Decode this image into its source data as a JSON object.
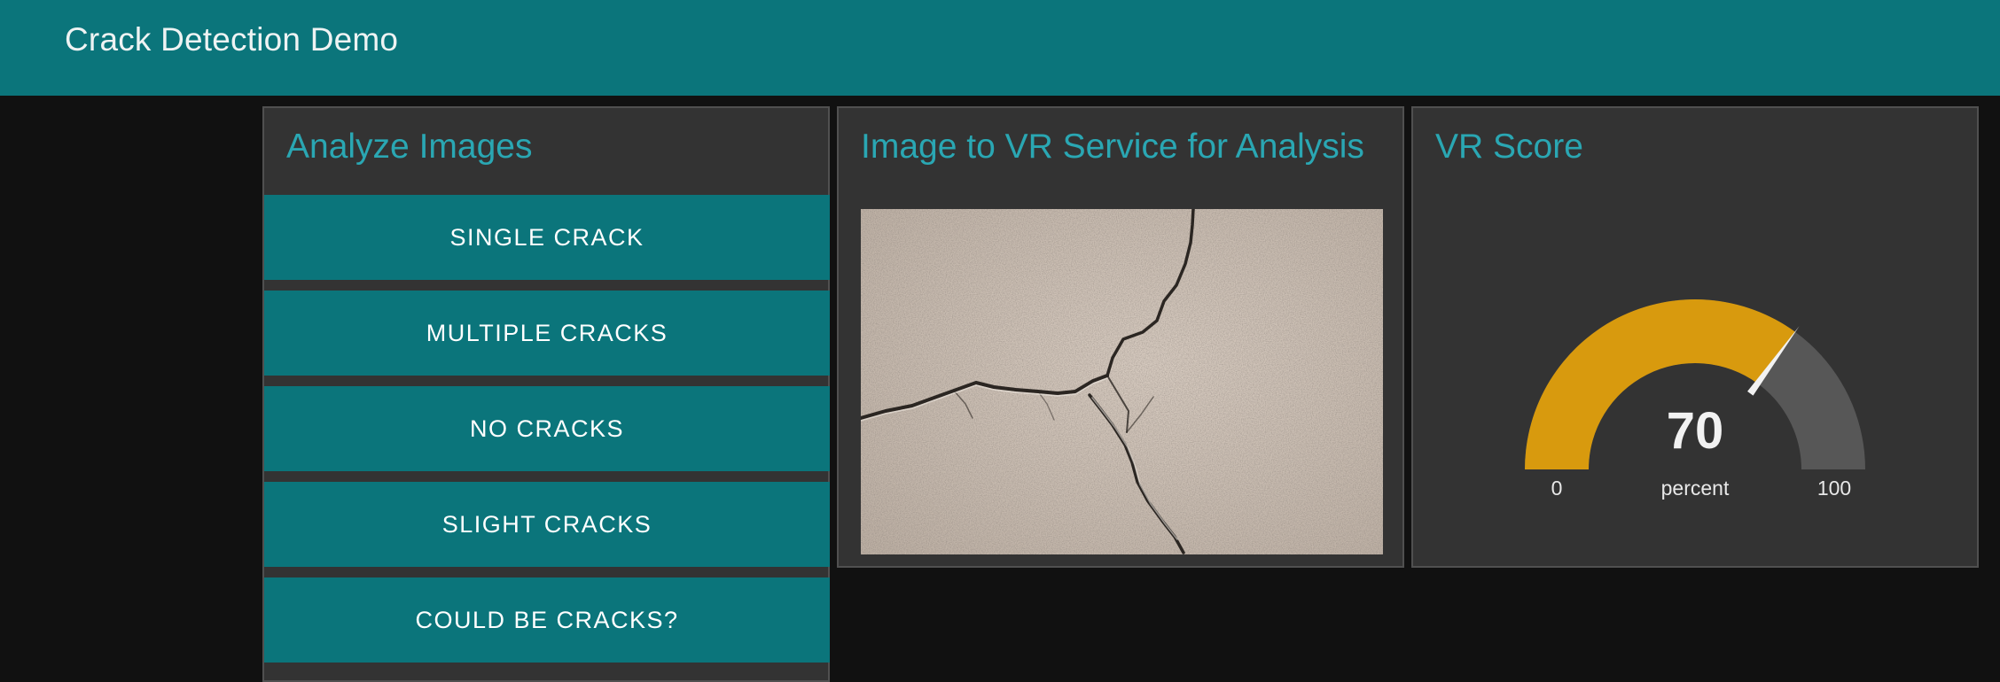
{
  "header": {
    "title": "Crack Detection Demo"
  },
  "analyze": {
    "title": "Analyze Images",
    "buttons": [
      {
        "label": "SINGLE CRACK"
      },
      {
        "label": "MULTIPLE CRACKS"
      },
      {
        "label": "NO CRACKS"
      },
      {
        "label": "SLIGHT CRACKS"
      },
      {
        "label": "COULD BE CRACKS?"
      }
    ]
  },
  "image_panel": {
    "title": "Image to VR Service for Analysis"
  },
  "score": {
    "title": "VR Score",
    "value": 70,
    "display_value": "70",
    "units": "percent",
    "min": 0,
    "max": 100,
    "min_label": "0",
    "max_label": "100"
  },
  "colors": {
    "header_bg": "#0b757b",
    "button_bg": "#0b757b",
    "panel_bg": "#333333",
    "title_text": "#2aa7b3",
    "gauge_fill": "#d89a0e",
    "gauge_track": "#575757",
    "needle": "#f2f2f2"
  }
}
